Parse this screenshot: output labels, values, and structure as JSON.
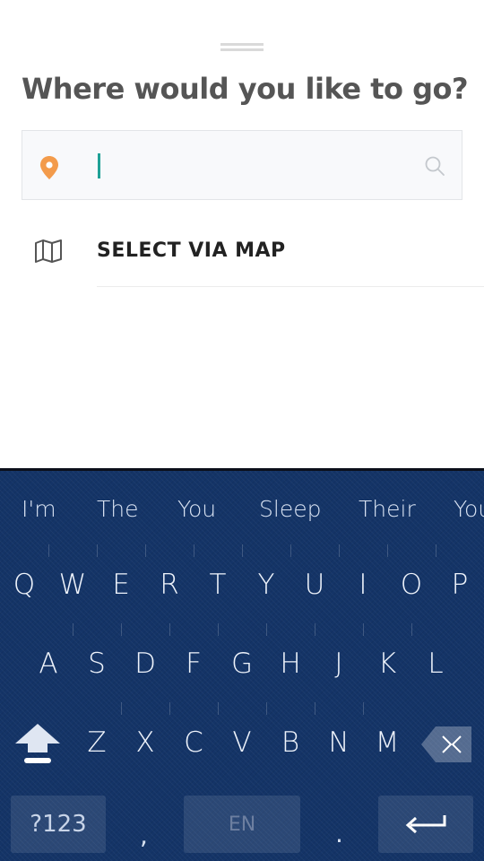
{
  "header": {
    "title": "Where would you like to go?"
  },
  "search": {
    "value": "",
    "placeholder": ""
  },
  "map_option": {
    "label": "SELECT VIA MAP"
  },
  "keyboard": {
    "suggestions": [
      "I'm",
      "The",
      "You",
      "Sleep",
      "Their",
      "You"
    ],
    "row1": [
      "Q",
      "W",
      "E",
      "R",
      "T",
      "Y",
      "U",
      "I",
      "O",
      "P"
    ],
    "row2": [
      "A",
      "S",
      "D",
      "F",
      "G",
      "H",
      "J",
      "K",
      "L"
    ],
    "row3": [
      "Z",
      "X",
      "C",
      "V",
      "B",
      "N",
      "M"
    ],
    "symbols_label": "?123",
    "comma": ",",
    "space_label": "EN",
    "period": "."
  },
  "colors": {
    "pin": "#f39b4b",
    "cursor": "#1fa196",
    "keyboard_bg": "#143467"
  },
  "icons": [
    "location-pin-icon",
    "search-icon",
    "map-icon",
    "shift-icon",
    "backspace-icon",
    "enter-icon"
  ]
}
